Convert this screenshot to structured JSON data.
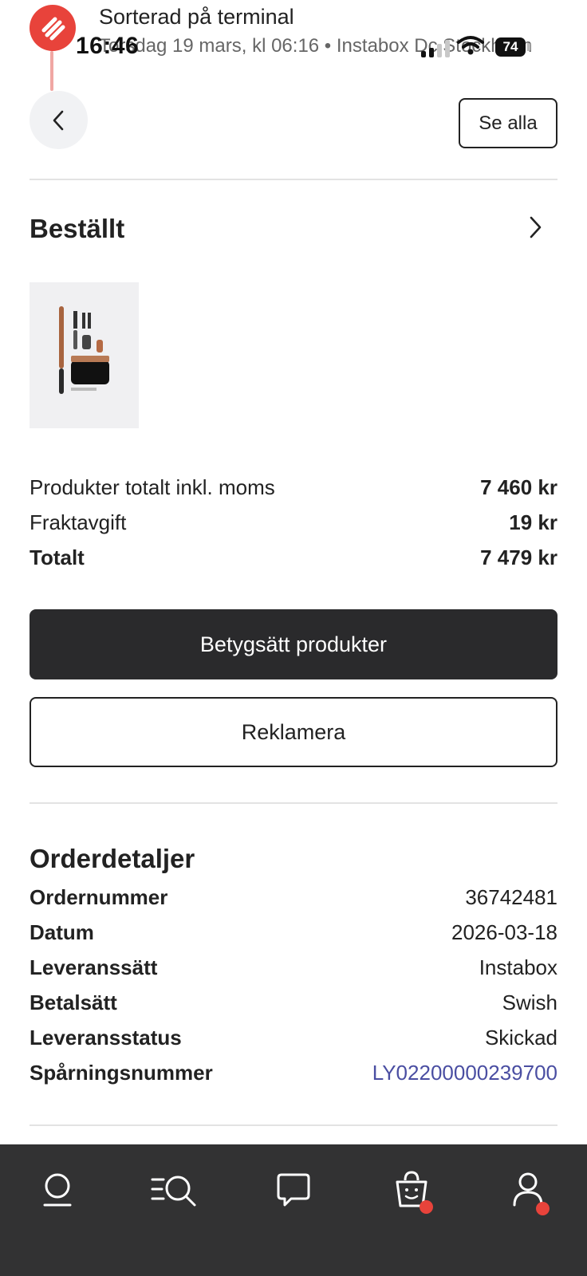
{
  "status_bar": {
    "time": "16:46",
    "battery": "74"
  },
  "notification": {
    "title": "Sorterad på terminal",
    "subtitle": "Torsdag 19 mars, kl 06:16 • Instabox Dc Stockholm"
  },
  "header": {
    "back_icon": "chevron-left-icon",
    "see_all_label": "Se alla"
  },
  "ordered": {
    "title": "Beställt",
    "chevron_icon": "chevron-right-icon",
    "product_image": "hair-styler-set"
  },
  "summary": {
    "rows": [
      {
        "label": "Produkter totalt inkl. moms",
        "value": "7 460 kr"
      },
      {
        "label": "Fraktavgift",
        "value": "19 kr"
      },
      {
        "label": "Totalt",
        "value": "7 479 kr"
      }
    ]
  },
  "actions": {
    "rate_label": "Betygsätt produkter",
    "complain_label": "Reklamera"
  },
  "order_details": {
    "title": "Orderdetaljer",
    "rows": [
      {
        "label": "Ordernummer",
        "value": "36742481"
      },
      {
        "label": "Datum",
        "value": "2026-03-18"
      },
      {
        "label": "Leveranssätt",
        "value": "Instabox"
      },
      {
        "label": "Betalsätt",
        "value": "Swish"
      },
      {
        "label": "Leveransstatus",
        "value": "Skickad"
      },
      {
        "label": "Spårningsnummer",
        "value": "LY02200000239700"
      }
    ]
  },
  "colors": {
    "accent_red": "#e8433b",
    "dark_button": "#2a2a2c",
    "link": "#4a4ea2"
  },
  "tab_bar": {
    "items": [
      {
        "icon": "home-icon"
      },
      {
        "icon": "search-icon"
      },
      {
        "icon": "chat-icon"
      },
      {
        "icon": "cart-icon",
        "badge": true
      },
      {
        "icon": "profile-icon",
        "badge": true
      }
    ]
  }
}
